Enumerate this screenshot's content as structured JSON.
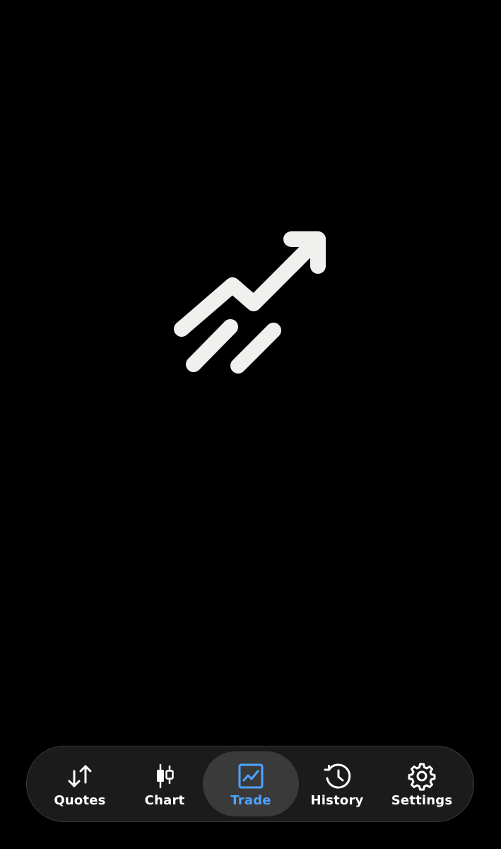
{
  "tabs": [
    {
      "id": "quotes",
      "label": "Quotes",
      "icon": "arrows-up-down-icon",
      "active": false
    },
    {
      "id": "chart",
      "label": "Chart",
      "icon": "candlestick-icon",
      "active": false
    },
    {
      "id": "trade",
      "label": "Trade",
      "icon": "line-chart-icon",
      "active": true
    },
    {
      "id": "history",
      "label": "History",
      "icon": "history-clock-icon",
      "active": false
    },
    {
      "id": "settings",
      "label": "Settings",
      "icon": "gear-icon",
      "active": false
    }
  ],
  "hero": {
    "icon": "trending-up-arrow-icon"
  },
  "colors": {
    "background": "#000000",
    "tabbar": "#1b1b1b",
    "active_pill": "#3a3a3a",
    "accent": "#4da3ff",
    "icon": "#f0f0ee"
  }
}
